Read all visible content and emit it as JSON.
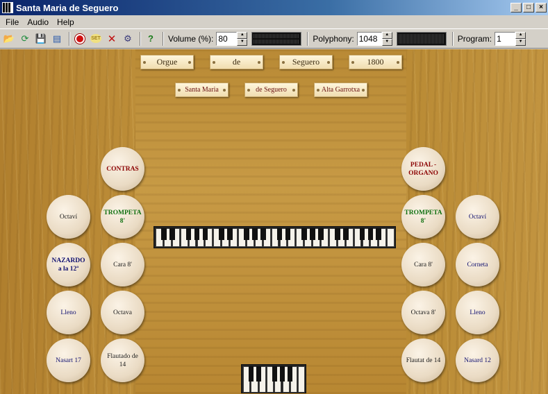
{
  "window": {
    "title": "Santa Maria de Seguero"
  },
  "menu": [
    "File",
    "Audio",
    "Help"
  ],
  "toolbar": {
    "volume_label": "Volume (%):",
    "volume_value": "80",
    "polyphony_label": "Polyphony:",
    "polyphony_value": "1048",
    "program_label": "Program:",
    "program_value": "1"
  },
  "plaques_top": [
    "Orgue",
    "de",
    "Seguero",
    "1800"
  ],
  "plaques_second": [
    "Santa Maria",
    "de Seguero",
    "Alta Garrotxa"
  ],
  "stops": {
    "left_outer": [
      "Octaví",
      "NAZARDO a la 12ª",
      "Lleno",
      "Nasart 17"
    ],
    "left_inner": [
      "CONTRAS",
      "TROMPETA 8'",
      "Cara 8'",
      "Octava",
      "Flautado de 14"
    ],
    "right_inner": [
      "PEDAL - ORGANO",
      "TROMPETA 8'",
      "Cara 8'",
      "Octava 8'",
      "Flautat de 14"
    ],
    "right_outer": [
      "Octaví",
      "Corneta",
      "Lleno",
      "Nasard 12"
    ]
  },
  "colors": {
    "title_gradient_start": "#0a246a",
    "stop_red": "#8b0000",
    "stop_green": "#107010",
    "stop_blue": "#101070"
  }
}
